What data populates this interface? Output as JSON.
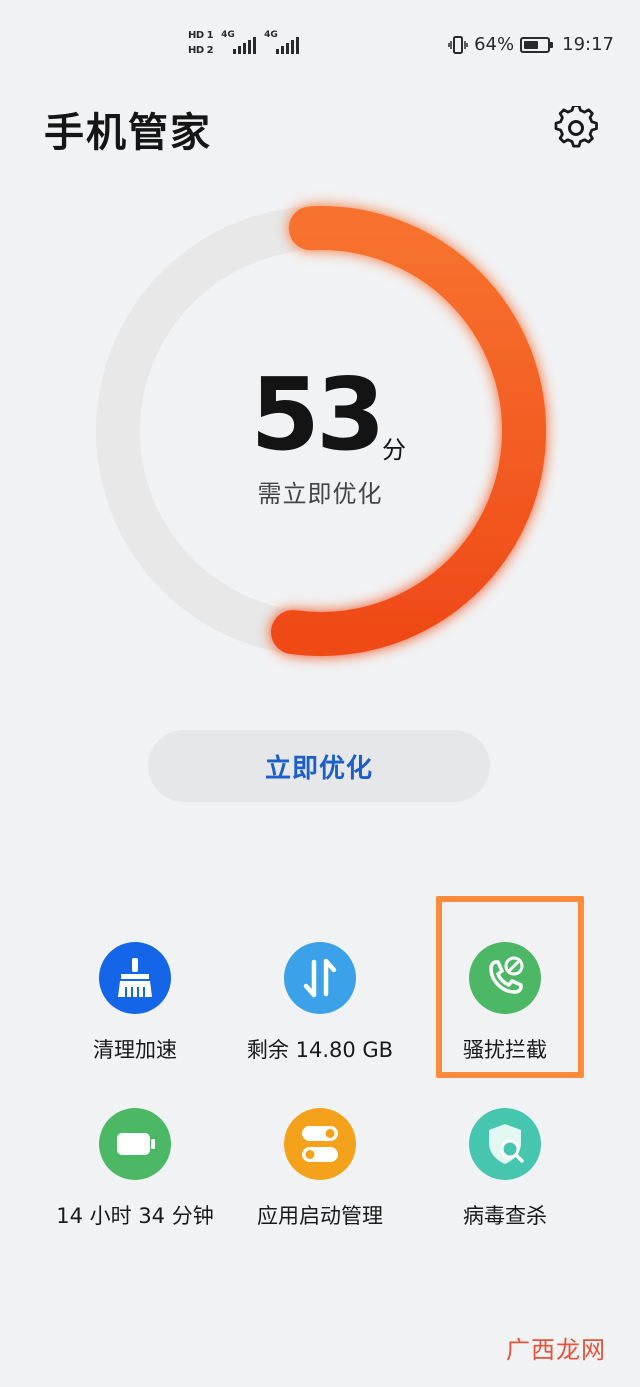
{
  "status_bar": {
    "sim1_badge": "HD 1",
    "sim2_badge": "HD 2",
    "sim1_network": "4G",
    "sim2_network": "4G",
    "battery_percent": "64%",
    "battery_level": 0.64,
    "time": "19:17"
  },
  "header": {
    "title": "手机管家",
    "settings_icon": "gear-icon"
  },
  "score": {
    "value": "53",
    "unit": "分",
    "status": "需立即优化",
    "fraction": 0.53,
    "ring_color": "#f05a22",
    "track_color": "#e8e8e9"
  },
  "optimize_button": {
    "label": "立即优化"
  },
  "tools": [
    {
      "label": "清理加速",
      "icon": "broom-icon",
      "color": "#1565e8"
    },
    {
      "label": "剩余 14.80 GB",
      "icon": "transfer-arrows-icon",
      "color": "#3ba2ea"
    },
    {
      "label": "骚扰拦截",
      "icon": "phone-block-icon",
      "color": "#4cb866"
    },
    {
      "label": "14 小时 34 分钟",
      "icon": "battery-icon",
      "color": "#4cb866"
    },
    {
      "label": "应用启动管理",
      "icon": "toggle-switch-icon",
      "color": "#f4a21c"
    },
    {
      "label": "病毒查杀",
      "icon": "shield-search-icon",
      "color": "#46c6ae"
    }
  ],
  "watermark": "广西龙网"
}
